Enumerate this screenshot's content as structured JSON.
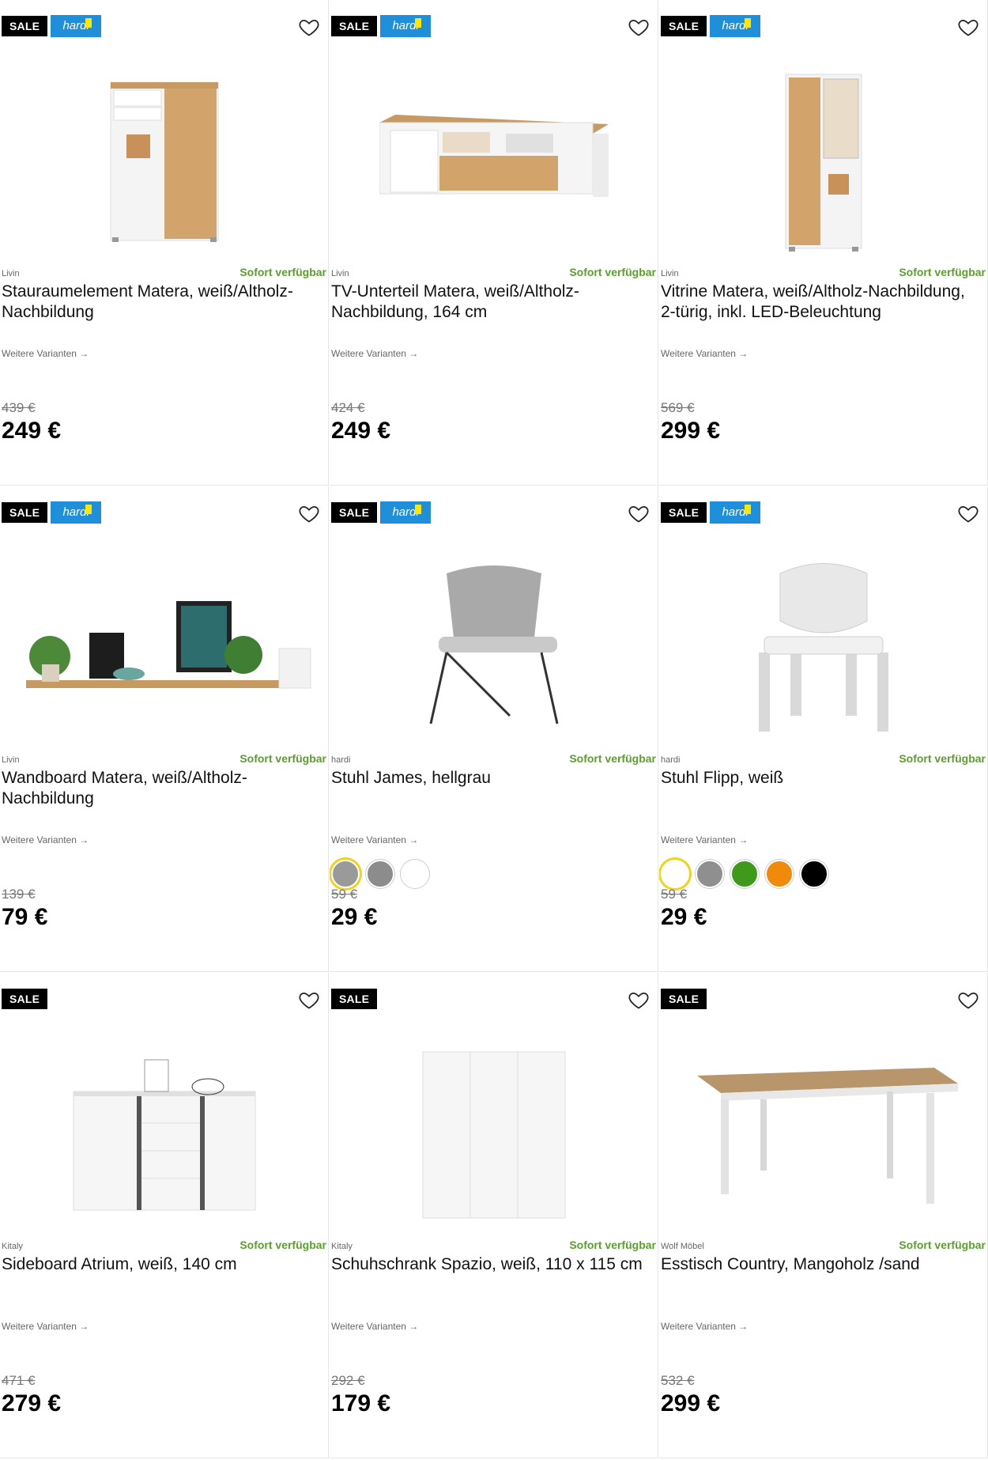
{
  "badges": {
    "sale": "SALE",
    "brand": "hardi"
  },
  "products": [
    {
      "maker": "Livin",
      "availability": "Sofort verfügbar",
      "title": "Stauraumelement Matera, weiß/Altholz-Nachbildung",
      "variants": "Weitere Varianten →",
      "old_price": "439 €",
      "price": "249 €",
      "brand_badge": true,
      "image": "cabinet-image"
    },
    {
      "maker": "Livin",
      "availability": "Sofort verfügbar",
      "title": "TV-Unterteil Matera, weiß/Altholz-Nachbildung, 164 cm",
      "variants": "Weitere Varianten →",
      "old_price": "424 €",
      "price": "249 €",
      "brand_badge": true,
      "image": "tv-unit-image"
    },
    {
      "maker": "Livin",
      "availability": "Sofort verfügbar",
      "title": "Vitrine Matera, weiß/Altholz-Nachbildung, 2-türig, inkl. LED-Beleuchtung",
      "variants": "Weitere Varianten →",
      "old_price": "569 €",
      "price": "299 €",
      "brand_badge": true,
      "image": "vitrine-image"
    },
    {
      "maker": "Livin",
      "availability": "Sofort verfügbar",
      "title": "Wandboard Matera, weiß/Altholz-Nachbildung",
      "variants": "Weitere Varianten →",
      "old_price": "139 €",
      "price": "79 €",
      "brand_badge": true,
      "image": "wall-shelf-image"
    },
    {
      "maker": "hardi",
      "availability": "Sofort verfügbar",
      "title": "Stuhl James, hellgrau",
      "variants": "Weitere Varianten →",
      "old_price": "59 €",
      "price": "29 €",
      "brand_badge": true,
      "image": "chair-james-image",
      "swatches": [
        "#9a9a9a",
        "#8c8c8c",
        "#ffffff"
      ]
    },
    {
      "maker": "hardi",
      "availability": "Sofort verfügbar",
      "title": "Stuhl Flipp, weiß",
      "variants": "Weitere Varianten →",
      "old_price": "59 €",
      "price": "29 €",
      "brand_badge": true,
      "image": "chair-flipp-image",
      "swatches": [
        "#ffffff",
        "#8f8f8f",
        "#3f9a1c",
        "#f08a0b",
        "#000000"
      ]
    },
    {
      "maker": "Kitaly",
      "availability": "Sofort verfügbar",
      "title": "Sideboard Atrium, weiß, 140 cm",
      "variants": "Weitere Varianten →",
      "old_price": "471 €",
      "price": "279 €",
      "brand_badge": false,
      "image": "sideboard-image"
    },
    {
      "maker": "Kitaly",
      "availability": "Sofort verfügbar",
      "title": "Schuhschrank Spazio, weiß, 110 x 115 cm",
      "variants": "Weitere Varianten →",
      "old_price": "292 €",
      "price": "179 €",
      "brand_badge": false,
      "image": "shoe-cabinet-image"
    },
    {
      "maker": "Wolf Möbel",
      "availability": "Sofort verfügbar",
      "title": "Esstisch Country, Mangoholz /sand",
      "variants": "Weitere Varianten →",
      "old_price": "532 €",
      "price": "299 €",
      "brand_badge": false,
      "image": "dining-table-image"
    }
  ],
  "colors": {
    "sale_bg": "#000000",
    "brand_bg": "#1e8fd8",
    "availability": "#5aa02c",
    "selected_swatch_ring": "#f2d21b"
  }
}
